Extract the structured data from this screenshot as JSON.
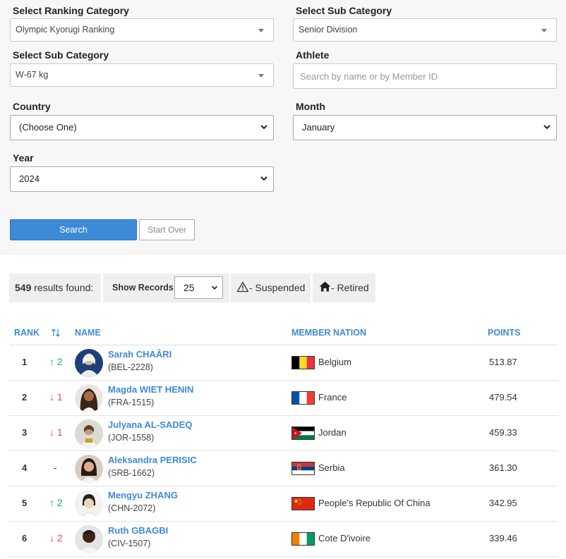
{
  "filters": {
    "ranking_category_label": "Select Ranking Category",
    "ranking_category_value": "Olympic Kyorugi Ranking",
    "sub_category_label_1": "Select Sub Category",
    "sub_category_value_1": "Senior Division",
    "sub_category_label_2": "Select Sub Category",
    "sub_category_value_2": "W-67 kg",
    "athlete_label": "Athlete",
    "athlete_placeholder": "Search by name or by Member ID",
    "country_label": "Country",
    "country_value": "(Choose One)",
    "month_label": "Month",
    "month_value": "January",
    "year_label": "Year",
    "year_value": "2024",
    "search_button": "Search",
    "start_over_button": "Start Over"
  },
  "results_bar": {
    "count": "549",
    "count_suffix": " results found:",
    "show_records_label": "Show Records:",
    "show_records_value": "25",
    "suspended_label": "- Suspended",
    "retired_label": "- Retired"
  },
  "table": {
    "headers": {
      "rank": "RANK",
      "name": "NAME",
      "nation": "MEMBER NATION",
      "points": "POINTS"
    },
    "rows": [
      {
        "rank": "1",
        "move_dir": "up",
        "move": "2",
        "name": "Sarah CHAÂRI",
        "member_id": "(BEL-2228)",
        "nation": "Belgium",
        "points": "513.87",
        "flag": "belgium"
      },
      {
        "rank": "2",
        "move_dir": "down",
        "move": "1",
        "name": "Magda WIET HENIN",
        "member_id": "(FRA-1515)",
        "nation": "France",
        "points": "479.54",
        "flag": "france"
      },
      {
        "rank": "3",
        "move_dir": "down",
        "move": "1",
        "name": "Julyana AL-SADEQ",
        "member_id": "(JOR-1558)",
        "nation": "Jordan",
        "points": "459.33",
        "flag": "jordan"
      },
      {
        "rank": "4",
        "move_dir": "none",
        "move": "-",
        "name": "Aleksandra PERISIC",
        "member_id": "(SRB-1662)",
        "nation": "Serbia",
        "points": "361.30",
        "flag": "serbia"
      },
      {
        "rank": "5",
        "move_dir": "up",
        "move": "2",
        "name": "Mengyu ZHANG",
        "member_id": "(CHN-2072)",
        "nation": "People's Republic Of China",
        "points": "342.95",
        "flag": "china"
      },
      {
        "rank": "6",
        "move_dir": "down",
        "move": "2",
        "name": "Ruth GBAGBI",
        "member_id": "(CIV-1507)",
        "nation": "Cote D'ivoire",
        "points": "339.46",
        "flag": "cotedivoire"
      }
    ]
  },
  "colors": {
    "accent": "#3d8ad6",
    "up": "#2aa56b",
    "down": "#d9534f"
  }
}
